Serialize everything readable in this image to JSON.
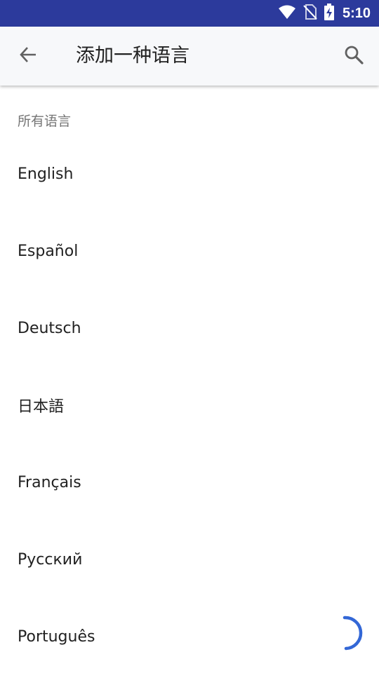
{
  "status_bar": {
    "time": "5:10",
    "icons": [
      "wifi-icon",
      "no-sim-icon",
      "battery-charging-icon"
    ],
    "background_color": "#2c3a9c"
  },
  "app_bar": {
    "back_icon": "arrow-back-icon",
    "title": "添加一种语言",
    "search_icon": "search-icon"
  },
  "section_header": "所有语言",
  "languages": [
    {
      "label": "English"
    },
    {
      "label": "Español"
    },
    {
      "label": "Deutsch"
    },
    {
      "label": "日本語"
    },
    {
      "label": "Français"
    },
    {
      "label": "Русский"
    },
    {
      "label": "Português"
    }
  ],
  "spinner_color": "#3367d6"
}
